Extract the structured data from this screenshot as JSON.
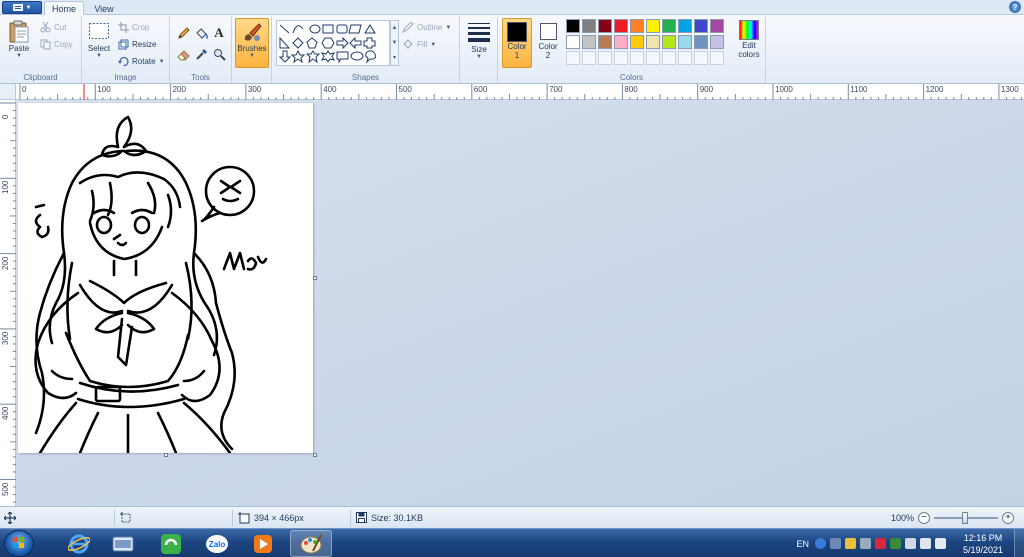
{
  "tabs": {
    "home": "Home",
    "view": "View"
  },
  "help": "?",
  "clipboard": {
    "paste": "Paste",
    "cut": "Cut",
    "copy": "Copy",
    "label": "Clipboard"
  },
  "image": {
    "select": "Select",
    "crop": "Crop",
    "resize": "Resize",
    "rotate": "Rotate",
    "label": "Image"
  },
  "tools": {
    "label": "Tools"
  },
  "brushes": {
    "label": "Brushes"
  },
  "shapes": {
    "outline": "Outline",
    "fill": "Fill",
    "label": "Shapes"
  },
  "size": {
    "label": "Size"
  },
  "color1": {
    "label": "Color",
    "num": "1",
    "value": "#000000"
  },
  "color2": {
    "label": "Color",
    "num": "2",
    "value": "#ffffff"
  },
  "colors": {
    "label": "Colors",
    "edit": "Edit colors",
    "row1": [
      "#000000",
      "#7f7f7f",
      "#880015",
      "#ed1c24",
      "#ff7f27",
      "#fff200",
      "#22b14c",
      "#00a2e8",
      "#3f48cc",
      "#a349a4"
    ],
    "row2": [
      "#ffffff",
      "#c3c3c3",
      "#b97a57",
      "#ffaec9",
      "#ffc90e",
      "#efe4b0",
      "#b5e61d",
      "#99d9ea",
      "#7092be",
      "#c8bfe7"
    ]
  },
  "ruler_top": [
    "0",
    "100",
    "200",
    "300",
    "400",
    "500",
    "600",
    "700",
    "800",
    "900",
    "1000",
    "1100",
    "1200",
    "1300"
  ],
  "ruler_left": [
    "0",
    "100",
    "200",
    "300",
    "400",
    "500"
  ],
  "status": {
    "dimensions": "394 × 466px",
    "filesize": "Size: 30.1KB",
    "zoom": "100%"
  },
  "tray": {
    "lang": "EN",
    "time": "12:16 PM",
    "date": "5/19/2021"
  }
}
